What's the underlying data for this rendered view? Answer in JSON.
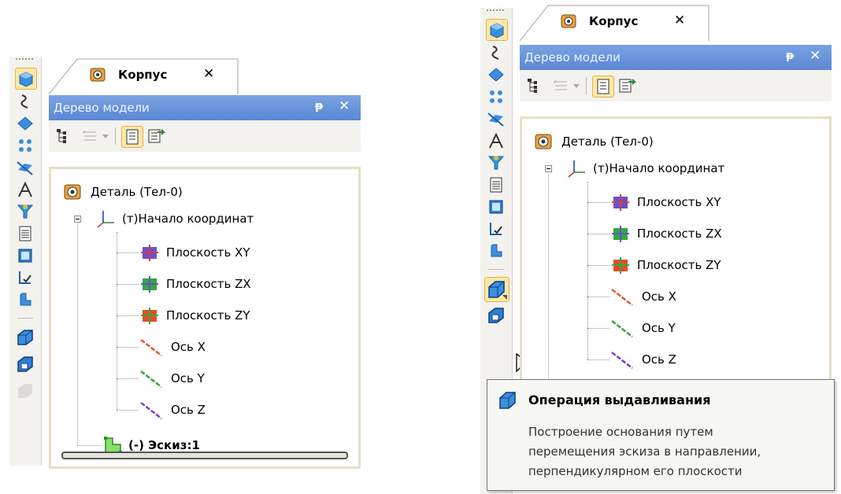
{
  "tab": {
    "title": "Корпус",
    "close": "✕"
  },
  "panel": {
    "title": "Дерево модели",
    "pin": "ᵽ",
    "close": "✕"
  },
  "tree": {
    "root": "Деталь (Тел-0)",
    "origin": "(т)Начало координат",
    "children": [
      "Плоскость XY",
      "Плоскость ZX",
      "Плоскость ZY",
      "Ось X",
      "Ось Y",
      "Ось Z"
    ],
    "sketch": "(-) Эскиз:1"
  },
  "tooltip": {
    "title": "Операция выдавливания",
    "lines": [
      "Построение основания путем",
      "перемещения эскиза в направлении,",
      "перпендикулярном его плоскости"
    ]
  },
  "colors": {
    "title_bar": "#5b87d4",
    "selected_bg": "#fbe7a8",
    "tree_border": "#e5dfc6",
    "plane_xy": "#6a4fd0",
    "plane_zx": "#2faa3a",
    "plane_zy": "#e84a2a",
    "axis_x": "#e35a30",
    "axis_y": "#3aa33a",
    "axis_z": "#7a40c8"
  }
}
